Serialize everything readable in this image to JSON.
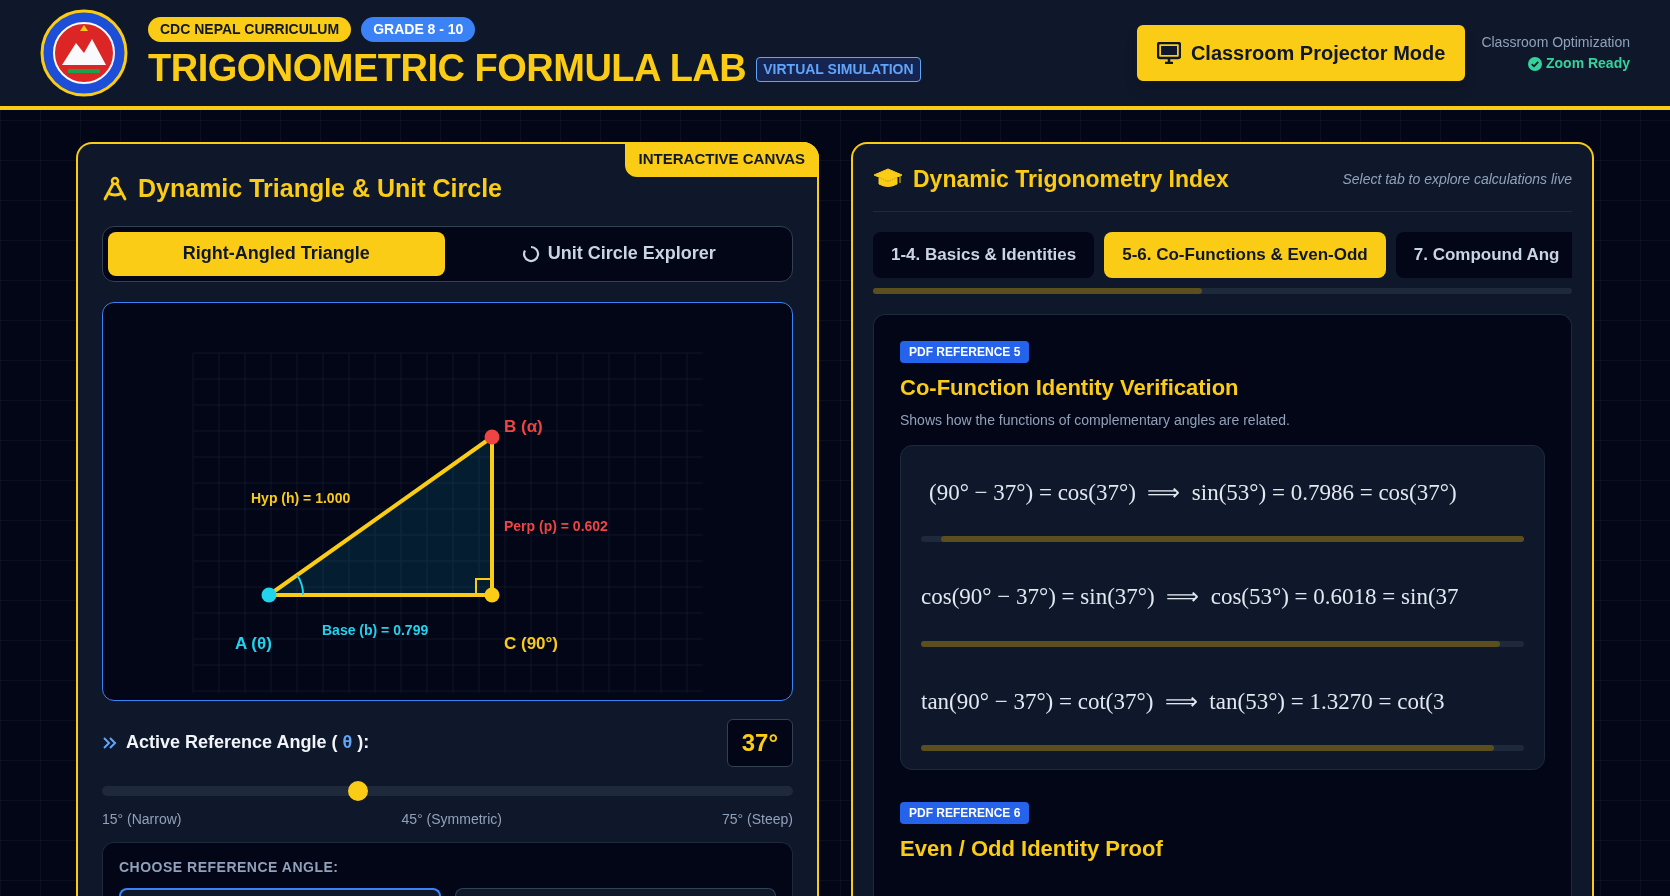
{
  "header": {
    "badges": [
      {
        "label": "CDC NEPAL CURRICULUM",
        "kind": "curriculum"
      },
      {
        "label": "GRADE 8 - 10",
        "kind": "grade"
      }
    ],
    "title": "TRIGONOMETRIC FORMULA LAB",
    "tag": "VIRTUAL SIMULATION",
    "projector_button": "Classroom Projector Mode",
    "optimization_label": "Classroom Optimization",
    "status": "Zoom Ready"
  },
  "canvas_panel": {
    "corner_badge": "INTERACTIVE CANVAS",
    "title": "Dynamic Triangle & Unit Circle",
    "mode_tabs": [
      {
        "label": "Right-Angled Triangle",
        "selected": true
      },
      {
        "label": "Unit Circle Explorer",
        "selected": false
      }
    ],
    "vertices": [
      {
        "label": "A (θ)",
        "color": "#22d3ee"
      },
      {
        "label": "B (α)",
        "color": "#ef4444"
      },
      {
        "label": "C (90°)",
        "color": "#facc15"
      }
    ],
    "sides": [
      {
        "label": "Hyp (h) = 1.000",
        "color": "#facc15"
      },
      {
        "label": "Perp (p) = 0.602",
        "color": "#ef4444"
      },
      {
        "label": "Base (b) = 0.799",
        "color": "#22d3ee"
      }
    ],
    "angle": {
      "label": "Active Reference Angle (",
      "symbol": "θ",
      "label_end": "):",
      "value": "37°",
      "level": 0.37,
      "ticks": [
        "15° (Narrow)",
        "45° (Symmetric)",
        "75° (Steep)"
      ]
    },
    "choose": {
      "heading": "CHOOSE REFERENCE ANGLE:",
      "options": [
        {
          "selected": true
        },
        {
          "selected": false
        }
      ]
    }
  },
  "index_panel": {
    "title": "Dynamic Trigonometry Index",
    "hint": "Select tab to explore calculations live",
    "tabs": [
      {
        "label": "1-4. Basics & Identities",
        "selected": false
      },
      {
        "label": "5-6. Co-Functions & Even-Odd",
        "selected": true
      },
      {
        "label": "7. Compound Ang",
        "selected": false
      }
    ],
    "sections": [
      {
        "reference": "PDF REFERENCE 5",
        "title": "Co-Function Identity Verification",
        "description": "Shows how the functions of complementary angles are related.",
        "formulas": [
          "(90° − 37°) = cos(37°)  ⟹  sin(53°) = 0.7986 = cos(37°)",
          "cos(90° − 37°) = sin(37°)  ⟹  cos(53°) = 0.6018 = sin(37",
          "tan(90° − 37°) = cot(37°)  ⟹  tan(53°) = 1.3270 = cot(3"
        ]
      },
      {
        "reference": "PDF REFERENCE 6",
        "title": "Even / Odd Identity Proof"
      }
    ]
  }
}
